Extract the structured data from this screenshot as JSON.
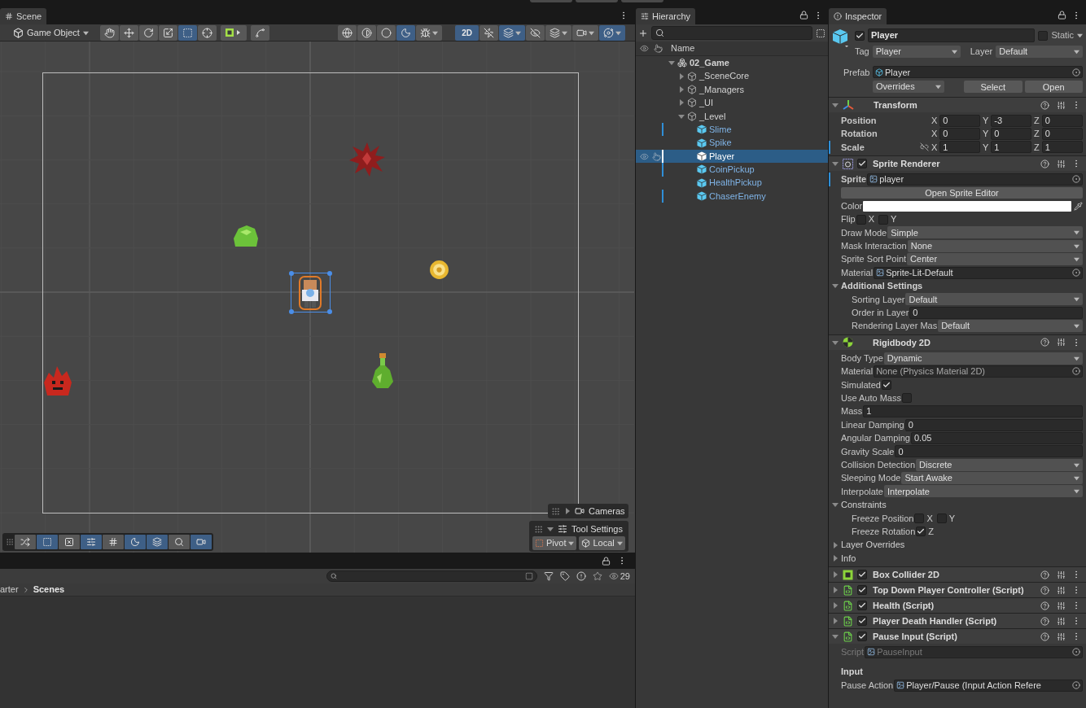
{
  "scene": {
    "tab": "Scene",
    "tool_mode": "Game Object",
    "tools": [
      {
        "selected": false
      },
      {
        "selected": false
      },
      {
        "selected": false
      },
      {
        "selected": false
      },
      {
        "selected": true
      },
      {
        "selected": false
      },
      {
        "selected": false
      },
      {
        "selected": false
      }
    ],
    "view_options": [
      {
        "selected": false
      },
      {
        "selected": false
      },
      {
        "selected": false
      },
      {
        "selected": true
      },
      {
        "selected": false
      }
    ],
    "mode_2d": {
      "label": "2D",
      "selected": true
    },
    "view_toggles": [
      {
        "selected": false
      },
      {
        "selected": true
      },
      {
        "selected": false
      },
      {
        "selected": false
      },
      {
        "selected": false
      },
      {
        "selected": true
      }
    ],
    "cameras": {
      "label": "Cameras",
      "expanded": false
    },
    "tool_settings": {
      "label": "Tool Settings",
      "expanded": true,
      "pivot": "Pivot",
      "space": "Local"
    },
    "overlay_tools": [
      {
        "selected": false
      },
      {
        "selected": true
      },
      {
        "selected": false
      },
      {
        "selected": true
      },
      {
        "selected": false
      },
      {
        "selected": true
      },
      {
        "selected": true
      },
      {
        "selected": false
      },
      {
        "selected": true
      }
    ]
  },
  "project": {
    "breadcrumb": [
      "arter",
      "Scenes"
    ],
    "count": "29"
  },
  "hierarchy": {
    "tab": "Hierarchy",
    "column": "Name",
    "items": [
      {
        "name": "02_Game",
        "kind": "scene",
        "expanded": true,
        "selected": false,
        "children": [
          {
            "name": "_SceneCore",
            "kind": "object",
            "expanded": false,
            "selected": false
          },
          {
            "name": "_Managers",
            "kind": "object",
            "expanded": false,
            "selected": false
          },
          {
            "name": "_UI",
            "kind": "object",
            "expanded": false,
            "selected": false
          },
          {
            "name": "_Level",
            "kind": "object",
            "expanded": true,
            "selected": false,
            "children": [
              {
                "name": "Slime",
                "kind": "prefab",
                "selected": false,
                "overridden": true
              },
              {
                "name": "Spike",
                "kind": "prefab",
                "selected": false,
                "overridden": false
              },
              {
                "name": "Player",
                "kind": "prefab",
                "selected": true,
                "overridden": true
              },
              {
                "name": "CoinPickup",
                "kind": "prefab",
                "selected": false,
                "overridden": true
              },
              {
                "name": "HealthPickup",
                "kind": "prefab",
                "selected": false,
                "overridden": false
              },
              {
                "name": "ChaserEnemy",
                "kind": "prefab",
                "selected": false,
                "overridden": true
              }
            ]
          }
        ]
      }
    ]
  },
  "inspector": {
    "tab": "Inspector",
    "object": {
      "name": "Player",
      "active": true,
      "static_label": "Static",
      "static": false,
      "tag_label": "Tag",
      "tag": "Player",
      "layer_label": "Layer",
      "layer": "Default",
      "prefab_label": "Prefab",
      "prefab": "Player",
      "overrides": "Overrides",
      "select": "Select",
      "open": "Open"
    },
    "components": [
      {
        "name": "Transform",
        "kind": "transform",
        "expanded": true,
        "rows": [
          {
            "kind": "vec3",
            "label": "Position",
            "axes": [
              {
                "axis": "X",
                "value": "0"
              },
              {
                "axis": "Y",
                "value": "-3"
              },
              {
                "axis": "Z",
                "value": "0"
              }
            ]
          },
          {
            "kind": "vec3",
            "label": "Rotation",
            "axes": [
              {
                "axis": "X",
                "value": "0"
              },
              {
                "axis": "Y",
                "value": "0"
              },
              {
                "axis": "Z",
                "value": "0"
              }
            ]
          },
          {
            "kind": "vec3",
            "label": "Scale",
            "overridden": true,
            "link_icon": true,
            "axes": [
              {
                "axis": "X",
                "value": "1"
              },
              {
                "axis": "Y",
                "value": "1"
              },
              {
                "axis": "Z",
                "value": "1"
              }
            ]
          }
        ]
      },
      {
        "name": "Sprite Renderer",
        "kind": "sprite",
        "enabled": true,
        "expanded": true,
        "rows": [
          {
            "kind": "asset",
            "label": "Sprite",
            "value": "player",
            "overridden": true
          },
          {
            "kind": "button",
            "label": "Open Sprite Editor"
          },
          {
            "kind": "color",
            "label": "Color",
            "color": "#ffffff"
          },
          {
            "kind": "toggles",
            "label": "Flip",
            "toggles": [
              {
                "axis": "X",
                "checked": false
              },
              {
                "axis": "Y",
                "checked": false
              }
            ]
          },
          {
            "kind": "dropdown",
            "label": "Draw Mode",
            "value": "Simple"
          },
          {
            "kind": "dropdown",
            "label": "Mask Interaction",
            "value": "None"
          },
          {
            "kind": "dropdown",
            "label": "Sprite Sort Point",
            "value": "Center"
          },
          {
            "kind": "asset",
            "label": "Material",
            "value": "Sprite-Lit-Default"
          },
          {
            "kind": "section",
            "label": "Additional Settings",
            "expanded": true,
            "rows": [
              {
                "kind": "dropdown",
                "label": "Sorting Layer",
                "value": "Default"
              },
              {
                "kind": "text",
                "label": "Order in Layer",
                "value": "0"
              },
              {
                "kind": "dropdown",
                "label": "Rendering Layer Mas",
                "value": "Default"
              }
            ]
          }
        ]
      },
      {
        "name": "Rigidbody 2D",
        "kind": "rigidbody",
        "expanded": true,
        "rows": [
          {
            "kind": "dropdown",
            "label": "Body Type",
            "value": "Dynamic"
          },
          {
            "kind": "object",
            "label": "Material",
            "value": "None (Physics Material 2D)"
          },
          {
            "kind": "checkbox",
            "label": "Simulated",
            "checked": true
          },
          {
            "kind": "checkbox",
            "label": "Use Auto Mass",
            "checked": false
          },
          {
            "kind": "text",
            "label": "Mass",
            "value": "1"
          },
          {
            "kind": "text",
            "label": "Linear Damping",
            "value": "0"
          },
          {
            "kind": "text",
            "label": "Angular Damping",
            "value": "0.05"
          },
          {
            "kind": "text",
            "label": "Gravity Scale",
            "value": "0"
          },
          {
            "kind": "dropdown",
            "label": "Collision Detection",
            "value": "Discrete"
          },
          {
            "kind": "dropdown",
            "label": "Sleeping Mode",
            "value": "Start Awake"
          },
          {
            "kind": "dropdown",
            "label": "Interpolate",
            "value": "Interpolate"
          },
          {
            "kind": "foldout",
            "label": "Constraints",
            "expanded": true,
            "rows": [
              {
                "kind": "toggles",
                "label": "Freeze Position",
                "toggles": [
                  {
                    "axis": "X",
                    "checked": false
                  },
                  {
                    "axis": "Y",
                    "checked": false
                  }
                ]
              },
              {
                "kind": "toggles",
                "label": "Freeze Rotation",
                "toggles": [
                  {
                    "axis": "Z",
                    "checked": true
                  }
                ]
              }
            ]
          },
          {
            "kind": "foldout",
            "label": "Layer Overrides",
            "expanded": false
          },
          {
            "kind": "foldout",
            "label": "Info",
            "expanded": false
          }
        ]
      },
      {
        "name": "Box Collider 2D",
        "kind": "collider",
        "enabled": true,
        "expanded": false
      },
      {
        "name": "Top Down Player Controller (Script)",
        "kind": "script",
        "enabled": true,
        "expanded": false
      },
      {
        "name": "Health (Script)",
        "kind": "script",
        "enabled": true,
        "expanded": false
      },
      {
        "name": "Player Death Handler (Script)",
        "kind": "script",
        "enabled": true,
        "expanded": false
      },
      {
        "name": "Pause Input (Script)",
        "kind": "script",
        "enabled": true,
        "expanded": true,
        "rows": [
          {
            "kind": "asset",
            "label": "Script",
            "value": "PauseInput",
            "disabled": true
          },
          {
            "kind": "heading",
            "label": "Input"
          },
          {
            "kind": "asset",
            "label": "Pause Action",
            "value": "Player/Pause (Input Action Refere"
          }
        ]
      }
    ]
  }
}
